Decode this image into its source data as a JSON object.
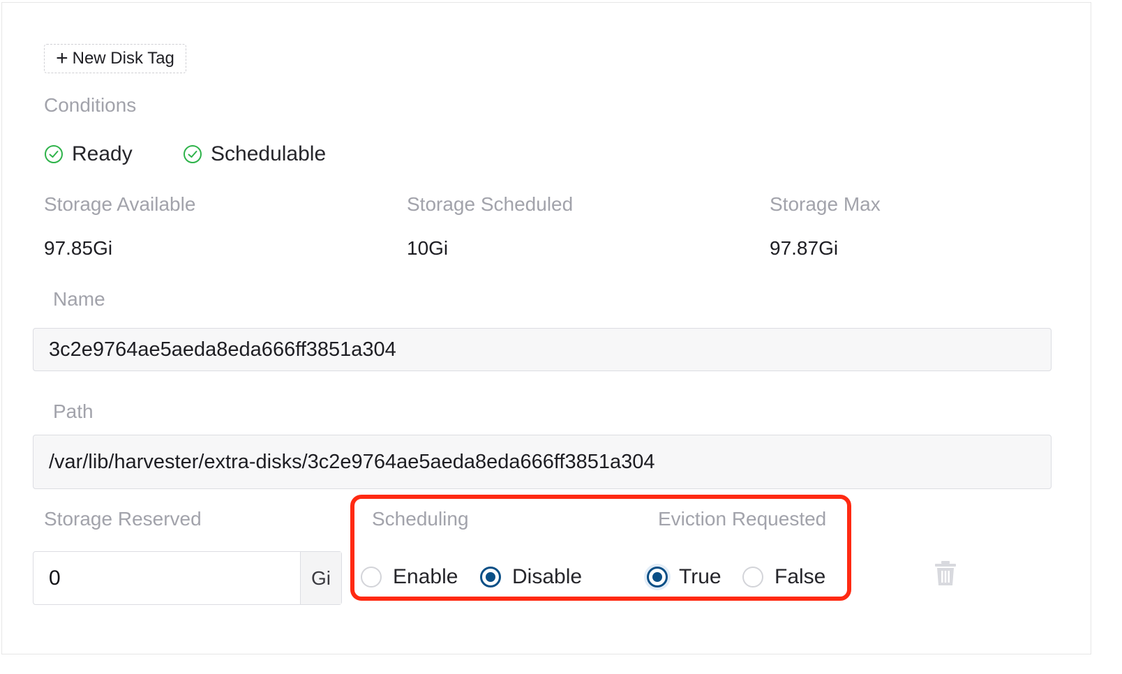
{
  "new_disk_tag_button": "New Disk Tag",
  "conditions": {
    "heading": "Conditions",
    "items": [
      "Ready",
      "Schedulable"
    ]
  },
  "storage": {
    "available_label": "Storage Available",
    "available_value": "97.85Gi",
    "scheduled_label": "Storage Scheduled",
    "scheduled_value": "10Gi",
    "max_label": "Storage Max",
    "max_value": "97.87Gi"
  },
  "name_field": {
    "label": "Name",
    "value": "3c2e9764ae5aeda8eda666ff3851a304"
  },
  "path_field": {
    "label": "Path",
    "value": "/var/lib/harvester/extra-disks/3c2e9764ae5aeda8eda666ff3851a304"
  },
  "storage_reserved": {
    "label": "Storage Reserved",
    "value": "0",
    "unit": "Gi"
  },
  "scheduling": {
    "label": "Scheduling",
    "options": [
      "Enable",
      "Disable"
    ],
    "selected": "Disable"
  },
  "eviction_requested": {
    "label": "Eviction Requested",
    "options": [
      "True",
      "False"
    ],
    "selected": "True"
  },
  "icons": {
    "condition": "check-circle-icon",
    "remove": "trash-icon"
  },
  "colors": {
    "accent": "#0a4f86",
    "success": "#2eb34a",
    "highlight": "#ff2a12",
    "label": "#a2a3ab"
  }
}
